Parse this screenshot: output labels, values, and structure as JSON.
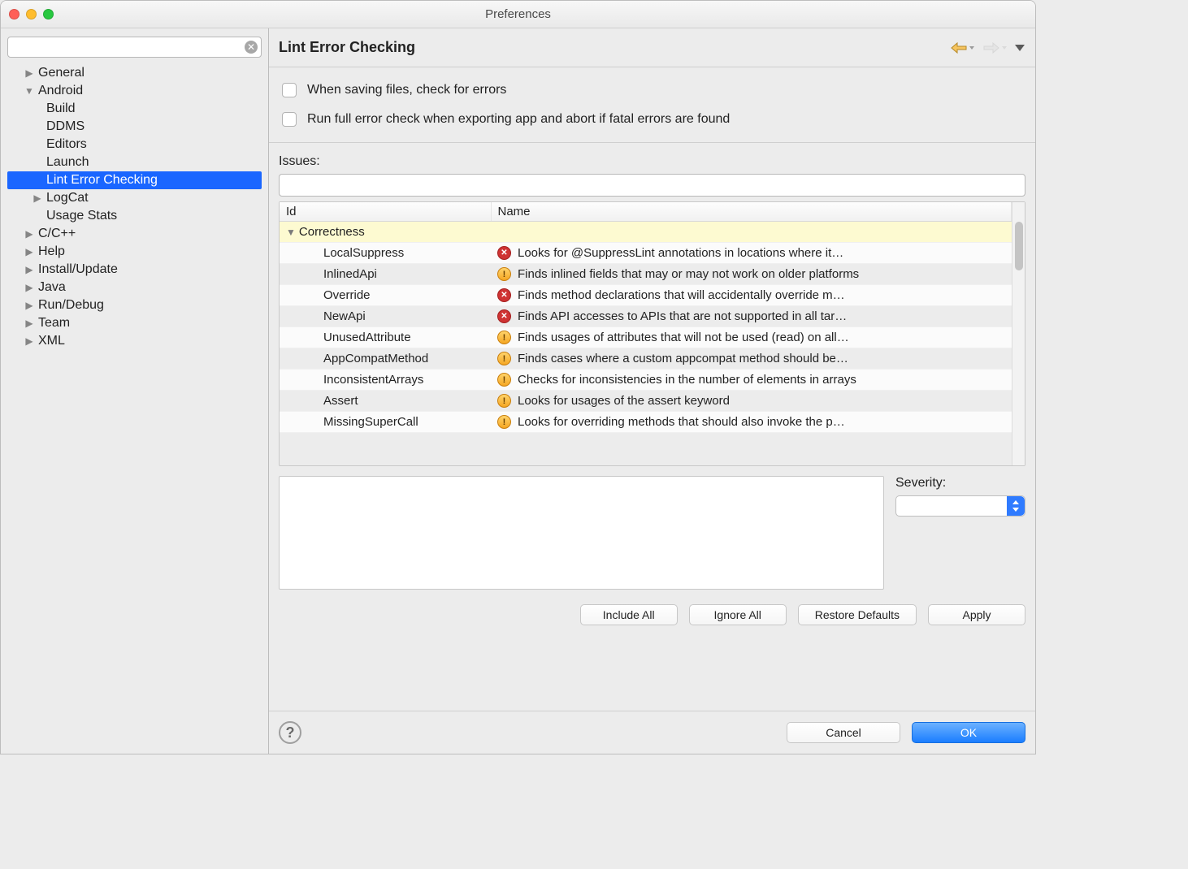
{
  "window": {
    "title": "Preferences"
  },
  "sidebar": {
    "search": {
      "value": ""
    },
    "items": [
      {
        "label": "General",
        "expanded": false,
        "depth": 1,
        "hasChildren": true
      },
      {
        "label": "Android",
        "expanded": true,
        "depth": 1,
        "hasChildren": true
      },
      {
        "label": "Build",
        "depth": 2
      },
      {
        "label": "DDMS",
        "depth": 2
      },
      {
        "label": "Editors",
        "depth": 2
      },
      {
        "label": "Launch",
        "depth": 2
      },
      {
        "label": "Lint Error Checking",
        "depth": 2,
        "selected": true
      },
      {
        "label": "LogCat",
        "depth": 2,
        "hasChildren": true,
        "expanded": false
      },
      {
        "label": "Usage Stats",
        "depth": 2
      },
      {
        "label": "C/C++",
        "expanded": false,
        "depth": 1,
        "hasChildren": true
      },
      {
        "label": "Help",
        "expanded": false,
        "depth": 1,
        "hasChildren": true
      },
      {
        "label": "Install/Update",
        "expanded": false,
        "depth": 1,
        "hasChildren": true
      },
      {
        "label": "Java",
        "expanded": false,
        "depth": 1,
        "hasChildren": true
      },
      {
        "label": "Run/Debug",
        "expanded": false,
        "depth": 1,
        "hasChildren": true
      },
      {
        "label": "Team",
        "expanded": false,
        "depth": 1,
        "hasChildren": true
      },
      {
        "label": "XML",
        "expanded": false,
        "depth": 1,
        "hasChildren": true
      }
    ]
  },
  "page": {
    "title": "Lint Error Checking",
    "check1_label": "When saving files, check for errors",
    "check1_checked": false,
    "check2_label": "Run full error check when exporting app and abort if fatal errors are found",
    "check2_checked": false,
    "issues_label": "Issues:",
    "filter_value": "",
    "columns": {
      "id": "Id",
      "name": "Name"
    },
    "group": "Correctness",
    "rows": [
      {
        "id": "LocalSuppress",
        "severity": "error",
        "name": "Looks for @SuppressLint annotations in locations where it…"
      },
      {
        "id": "InlinedApi",
        "severity": "warning",
        "name": "Finds inlined fields that may or may not work on older platforms"
      },
      {
        "id": "Override",
        "severity": "error",
        "name": "Finds method declarations that will accidentally override m…"
      },
      {
        "id": "NewApi",
        "severity": "error",
        "name": "Finds API accesses to APIs that are not supported in all tar…"
      },
      {
        "id": "UnusedAttribute",
        "severity": "warning",
        "name": "Finds usages of attributes that will not be used (read) on all…"
      },
      {
        "id": "AppCompatMethod",
        "severity": "warning",
        "name": "Finds cases where a custom appcompat method should be…"
      },
      {
        "id": "InconsistentArrays",
        "severity": "warning",
        "name": "Checks for inconsistencies in the number of elements in arrays"
      },
      {
        "id": "Assert",
        "severity": "warning",
        "name": "Looks for usages of the assert keyword"
      },
      {
        "id": "MissingSuperCall",
        "severity": "warning",
        "name": "Looks for overriding methods that should also invoke the p…"
      }
    ],
    "severity_label": "Severity:",
    "severity_value": "",
    "buttons": {
      "include_all": "Include All",
      "ignore_all": "Ignore All",
      "restore_defaults": "Restore Defaults",
      "apply": "Apply"
    }
  },
  "footer": {
    "cancel": "Cancel",
    "ok": "OK"
  }
}
